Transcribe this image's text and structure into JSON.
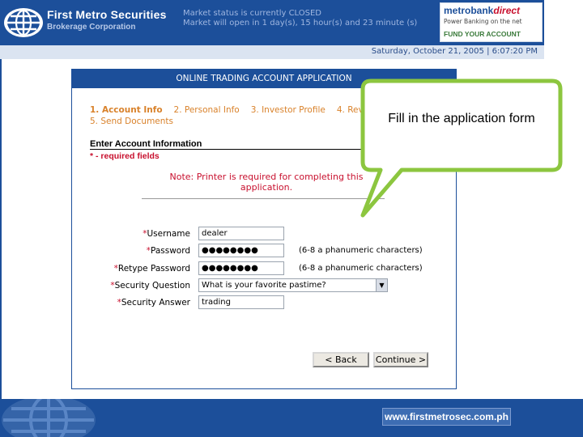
{
  "header": {
    "brand_name": "First Metro Securities",
    "brand_sub": "Brokerage Corporation",
    "market_line1": "Market status is currently CLOSED",
    "market_line2": "Market will open in 1 day(s), 15 hour(s) and 23 minute (s)",
    "partner": {
      "name_main": "metrobank",
      "name_accent": "direct",
      "tagline": "Power Banking on the net",
      "cta": "FUND YOUR ACCOUNT"
    },
    "datetime": "Saturday, October 21, 2005 | 6:07:20 PM"
  },
  "form": {
    "title": "ONLINE TRADING ACCOUNT APPLICATION",
    "steps": [
      {
        "label": "1. Account Info"
      },
      {
        "label": "2. Personal Info"
      },
      {
        "label": "3. Investor Profile"
      },
      {
        "label": "4. Rev"
      },
      {
        "label": "5. Send Documents"
      }
    ],
    "section_heading": "Enter Account Information",
    "required_note": "* - required fields",
    "printer_note": "Note: Printer is required for completing this application.",
    "fields": {
      "username": {
        "label": "Username",
        "value": "dealer"
      },
      "password": {
        "label": "Password",
        "value": "●●●●●●●●",
        "hint": "(6-8 a phanumeric characters)"
      },
      "retype_password": {
        "label": "Retype Password",
        "value": "●●●●●●●●",
        "hint": "(6-8 a phanumeric characters)"
      },
      "security_question": {
        "label": "Security Question",
        "value": "What is your favorite pastime?"
      },
      "security_answer": {
        "label": "Security Answer",
        "value": "trading"
      }
    },
    "buttons": {
      "back": "< Back",
      "continue": "Continue >"
    }
  },
  "callout": {
    "text": "Fill in the application form"
  },
  "footer": {
    "url": "www.firstmetrosec.com.ph"
  },
  "colors": {
    "brand_blue": "#1c4f9a",
    "step_orange": "#d9822b",
    "required_red": "#c8102e",
    "callout_green": "#8cc63f"
  }
}
